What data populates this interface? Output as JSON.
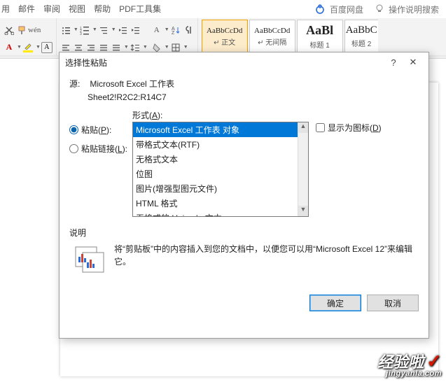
{
  "tabs": {
    "t0": "用",
    "t1": "邮件",
    "t2": "审阅",
    "t3": "视图",
    "t4": "帮助",
    "t5": "PDF工具集",
    "t6": "百度网盘",
    "tip": "操作说明搜索"
  },
  "styles": {
    "s1": {
      "sample": "AaBbCcDd",
      "label": "↵ 正文"
    },
    "s2": {
      "sample": "AaBbCcDd",
      "label": "↵ 无间隔"
    },
    "s3": {
      "sample": "AaBl",
      "label": "标题 1"
    },
    "s4": {
      "sample": "AaBbC",
      "label": "标题 2"
    }
  },
  "dialog": {
    "title": "选择性粘贴",
    "source_label": "源:",
    "source_val": "Microsoft Excel 工作表",
    "source_ref": "Sheet2!R2C2:R14C7",
    "paste_label": "粘贴(",
    "paste_key": "P",
    "paste_label2": "):",
    "pastelink_label": "粘贴链接(",
    "pastelink_key": "L",
    "pastelink_label2": "):",
    "format_label": "形式(",
    "format_key": "A",
    "format_label2": "):",
    "formats": {
      "f0": "Microsoft Excel 工作表 对象",
      "f1": "带格式文本(RTF)",
      "f2": "无格式文本",
      "f3": "位图",
      "f4": "图片(增强型图元文件)",
      "f5": "HTML 格式",
      "f6": "无格式的 Unicode 文本"
    },
    "displayicon_pre": "显示为图标(",
    "displayicon_key": "D",
    "displayicon_post": ")",
    "desc_label": "说明",
    "desc_text": "将“剪贴板”中的内容插入到您的文档中，以便您可以用“Microsoft Excel 12”来编辑它。",
    "ok": "确定",
    "cancel": "取消",
    "help": "?",
    "close": "✕"
  },
  "watermark": {
    "big": "经验啦",
    "small": "jingyanla.com",
    "check": "✓"
  }
}
